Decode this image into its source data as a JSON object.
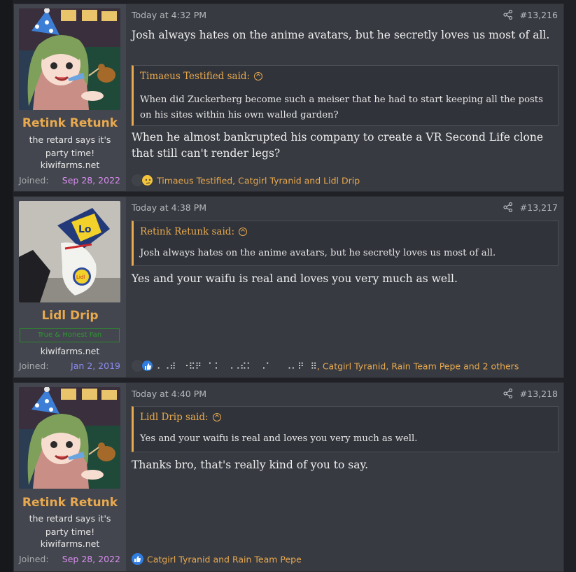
{
  "posts": [
    {
      "user": {
        "name": "Retink Retunk",
        "title": "the retard says it's party time!",
        "site": "kiwifarms.net",
        "joined_label": "Joined:",
        "joined_date": "Sep 28, 2022",
        "joined_color": "#d98ef0"
      },
      "date": "Today at 4:32 PM",
      "number": "#13,216",
      "quote": {
        "author": "Timaeus Testified said:",
        "text": "When did Zuckerberg become such a meiser that he had to start keeping all the posts on his sites within his own walled garden?"
      },
      "message": "When he almost bankrupted his company to create a VR Second Life clone that still can't render legs?",
      "message_pre": "Josh always hates on the anime avatars, but he secretly loves us most of all.",
      "reactions": "Timaeus Testified, Catgirl Tyranid and Lidl Drip"
    },
    {
      "user": {
        "name": "Lidl Drip",
        "banner": "True & Honest Fan",
        "site": "kiwifarms.net",
        "joined_label": "Joined:",
        "joined_date": "Jan 2, 2019",
        "joined_color": "#8c8cf2"
      },
      "date": "Today at 4:38 PM",
      "number": "#13,217",
      "quote": {
        "author": "Retink Retunk said:",
        "text": "Josh always hates on the anime avatars, but he secretly loves us most of all."
      },
      "message": "Yes and your waifu is real and loves you very much as well.",
      "reactions_braille": "⠄⠠⠾⠀⠐⠯⠟⠀⠁⠅⠀⠠⠠⠮⠅⠀⠠⠁⠀⠀⠠⠄⠟⠀⠿",
      "reactions": ", Catgirl Tyranid, Rain Team Pepe and 2 others"
    },
    {
      "user": {
        "name": "Retink Retunk",
        "title": "the retard says it's party time!",
        "site": "kiwifarms.net",
        "joined_label": "Joined:",
        "joined_date": "Sep 28, 2022",
        "joined_color": "#d98ef0"
      },
      "date": "Today at 4:40 PM",
      "number": "#13,218",
      "quote": {
        "author": "Lidl Drip said:",
        "text": "Yes and your waifu is real and loves you very much as well."
      },
      "message": "Thanks bro, that's really kind of you to say.",
      "reactions": "Catgirl Tyranid and Rain Team Pepe"
    }
  ],
  "icons": {
    "share": "share-icon",
    "quote_arrow": "arrow-up-circle-icon",
    "reaction_like": "thumbs-up-icon",
    "reaction_thinking": "thinking-face-icon"
  }
}
